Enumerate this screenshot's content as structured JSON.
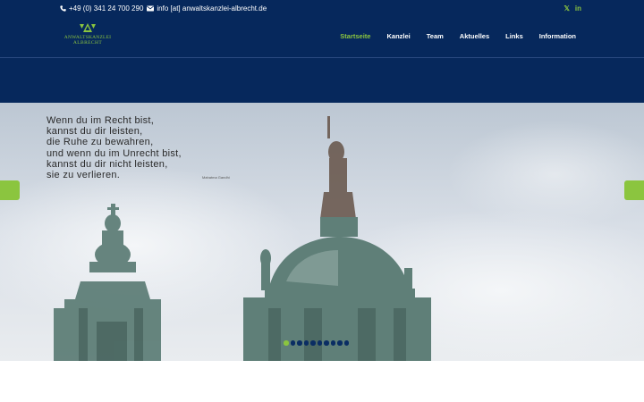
{
  "topbar": {
    "phone": "+49 (0) 341 24 700 290",
    "email": "info [at] anwaltskanzlei-albrecht.de",
    "social": [
      "xing-icon",
      "linkedin-icon"
    ],
    "social_labels": [
      "𝕏",
      "in"
    ]
  },
  "logo": {
    "line1": "ANWALTSKANZLEI",
    "line2": "ALBRECHT"
  },
  "nav": {
    "items": [
      {
        "label": "Startseite",
        "active": true
      },
      {
        "label": "Kanzlei",
        "active": false
      },
      {
        "label": "Team",
        "active": false
      },
      {
        "label": "Aktuelles",
        "active": false
      },
      {
        "label": "Links",
        "active": false
      },
      {
        "label": "Information",
        "active": false
      }
    ]
  },
  "hero": {
    "quote_lines": [
      "Wenn du im Recht bist,",
      "kannst du dir leisten,",
      "die Ruhe zu bewahren,",
      "und wenn du im Unrecht bist,",
      "kannst du dir nicht leisten,",
      "sie zu verlieren."
    ],
    "author": "Mahatma Gandhi",
    "slide_count": 10,
    "active_slide": 1
  },
  "colors": {
    "navy": "#06285c",
    "accent": "#8bc53f"
  }
}
